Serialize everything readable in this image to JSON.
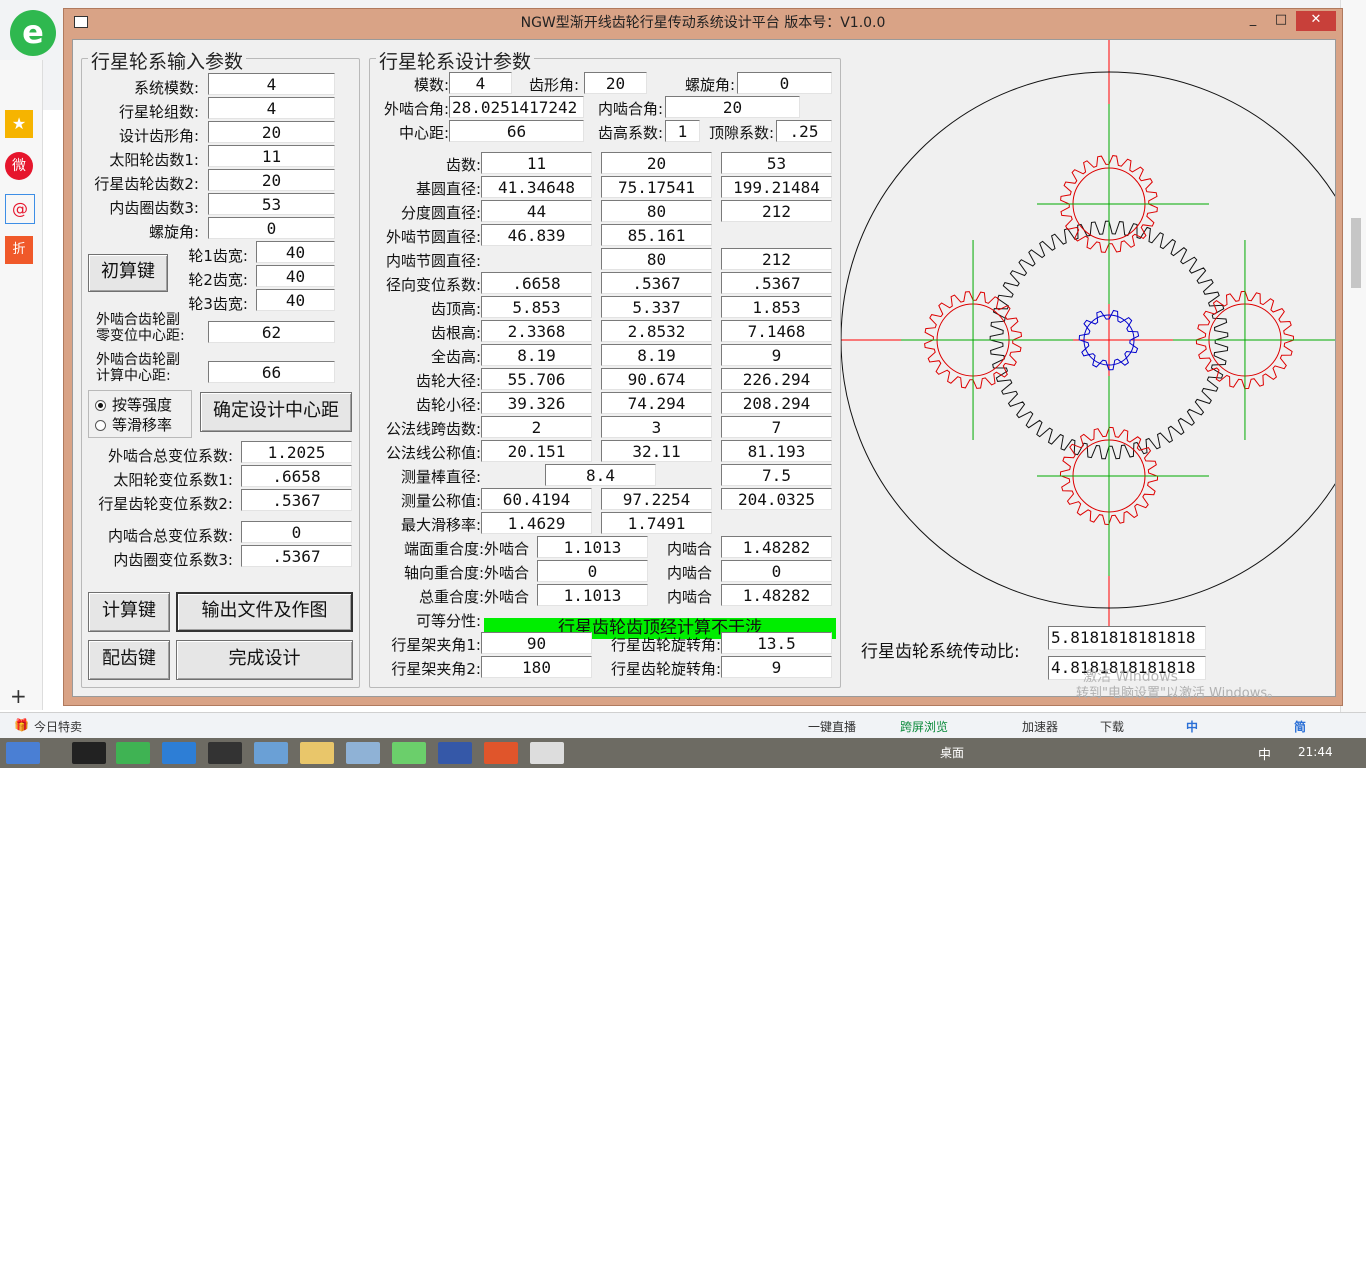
{
  "app": {
    "title": "NGW型渐开线齿轮行星传动系统设计平台  版本号：V1.0.0",
    "window_controls": [
      "_",
      "□",
      "✕"
    ]
  },
  "input_panel": {
    "title": "行星轮系输入参数",
    "rows": [
      {
        "label": "系统模数:",
        "value": "4"
      },
      {
        "label": "行星轮组数:",
        "value": "4"
      },
      {
        "label": "设计齿形角:",
        "value": "20"
      },
      {
        "label": "太阳轮齿数1:",
        "value": "11"
      },
      {
        "label": "行星齿轮齿数2:",
        "value": "20"
      },
      {
        "label": "内齿圈齿数3:",
        "value": "53"
      },
      {
        "label": "螺旋角:",
        "value": "0"
      }
    ],
    "init_button": "初算键",
    "widths": [
      {
        "label": "轮1齿宽:",
        "value": "40"
      },
      {
        "label": "轮2齿宽:",
        "value": "40"
      },
      {
        "label": "轮3齿宽:",
        "value": "40"
      }
    ],
    "zero_shift_label_1": "外啮合齿轮副",
    "zero_shift_label_2": "零变位中心距:",
    "zero_shift_value": "62",
    "calc_center_label_1": "外啮合齿轮副",
    "calc_center_label_2": "计算中心距:",
    "calc_center_value": "66",
    "radio_equal_strength": "按等强度",
    "radio_equal_slip": "等滑移率",
    "confirm_center_button": "确定设计中心距",
    "ext_total_shift_label": "外啮合总变位系数:",
    "ext_total_shift_value": "1.2025",
    "sun_shift_label": "太阳轮变位系数1:",
    "sun_shift_value": ".6658",
    "planet_shift_label": "行星齿轮变位系数2:",
    "planet_shift_value": ".5367",
    "int_total_shift_label": "内啮合总变位系数:",
    "int_total_shift_value": "0",
    "ring_shift_label": "内齿圈变位系数3:",
    "ring_shift_value": ".5367",
    "calc_button": "计算键",
    "export_button": "输出文件及作图",
    "match_button": "配齿键",
    "finish_button": "完成设计"
  },
  "design_panel": {
    "title": "行星轮系设计参数",
    "module_label": "模数:",
    "module_value": "4",
    "pressure_angle_label": "齿形角:",
    "pressure_angle_value": "20",
    "helix_label": "螺旋角:",
    "helix_value": "0",
    "ext_mesh_angle_label": "外啮合角:",
    "ext_mesh_angle_value": "28.0251417242",
    "int_mesh_angle_label": "内啮合角:",
    "int_mesh_angle_value": "20",
    "center_label": "中心距:",
    "center_value": "66",
    "addendum_coef_label": "齿高系数:",
    "addendum_coef_value": "1",
    "clearance_coef_label": "顶隙系数:",
    "clearance_coef_value": ".25",
    "table": [
      {
        "label": "齿数:",
        "v": [
          "11",
          "20",
          "53"
        ]
      },
      {
        "label": "基圆直径:",
        "v": [
          "41.34648",
          "75.17541",
          "199.21484"
        ]
      },
      {
        "label": "分度圆直径:",
        "v": [
          "44",
          "80",
          "212"
        ]
      },
      {
        "label": "外啮节圆直径:",
        "v": [
          "46.839",
          "85.161",
          ""
        ]
      },
      {
        "label": "内啮节圆直径:",
        "v": [
          "",
          "80",
          "212"
        ]
      },
      {
        "label": "径向变位系数:",
        "v": [
          ".6658",
          ".5367",
          ".5367"
        ]
      },
      {
        "label": "齿顶高:",
        "v": [
          "5.853",
          "5.337",
          "1.853"
        ]
      },
      {
        "label": "齿根高:",
        "v": [
          "2.3368",
          "2.8532",
          "7.1468"
        ]
      },
      {
        "label": "全齿高:",
        "v": [
          "8.19",
          "8.19",
          "9"
        ]
      },
      {
        "label": "齿轮大径:",
        "v": [
          "55.706",
          "90.674",
          "226.294"
        ]
      },
      {
        "label": "齿轮小径:",
        "v": [
          "39.326",
          "74.294",
          "208.294"
        ]
      },
      {
        "label": "公法线跨齿数:",
        "v": [
          "2",
          "3",
          "7"
        ]
      },
      {
        "label": "公法线公称值:",
        "v": [
          "20.151",
          "32.11",
          "81.193"
        ]
      }
    ],
    "pin_label": "测量棒直径:",
    "pin_value_12": "8.4",
    "pin_value_3": "7.5",
    "measure_label": "测量公称值:",
    "measure_values": [
      "60.4194",
      "97.2254",
      "204.0325"
    ],
    "slip_label": "最大滑移率:",
    "slip_values": [
      "1.4629",
      "1.7491"
    ],
    "transverse_label": "端面重合度:外啮合",
    "transverse_ext": "1.1013",
    "transverse_int_label": "内啮合",
    "transverse_int": "1.48282",
    "axial_label": "轴向重合度:外啮合",
    "axial_ext": "0",
    "axial_int_label": "内啮合",
    "axial_int": "0",
    "total_label": "总重合度:外啮合",
    "total_ext": "1.1013",
    "total_int_label": "内啮合",
    "total_int": "1.48282",
    "divisible_label": "可等分性:",
    "status_message": "行星齿轮齿顶经计算不干涉",
    "carrier_angle_1_label": "行星架夹角1:",
    "carrier_angle_1": "90",
    "carrier_angle_2_label": "行星架夹角2:",
    "carrier_angle_2": "180",
    "planet_rot_1_label": "行星齿轮旋转角:",
    "planet_rot_1": "13.5",
    "planet_rot_2_label": "行星齿轮旋转角:",
    "planet_rot_2": "9"
  },
  "drawing": {
    "ratio_label": "行星齿轮系统传动比:",
    "ratio_1": "5.8181818181818",
    "ratio_2": "4.8181818181818",
    "colors": {
      "sun": "#0000cc",
      "planet": "#dd0000",
      "ring": "#111111",
      "center": "#00aa00",
      "axis": "#ff0000"
    },
    "watermark_1": "激活 Windows",
    "watermark_2": "转到\"电脑设置\"以激活 Windows。"
  },
  "browser": {
    "status_left": "今日特卖",
    "status_items": [
      "一键直播",
      "跨屏浏览",
      "加速器",
      "下载"
    ],
    "ime_items": [
      "中",
      "简"
    ],
    "taskbar_desktop": "桌面",
    "taskbar_ime": "中",
    "clock": "21:44"
  }
}
